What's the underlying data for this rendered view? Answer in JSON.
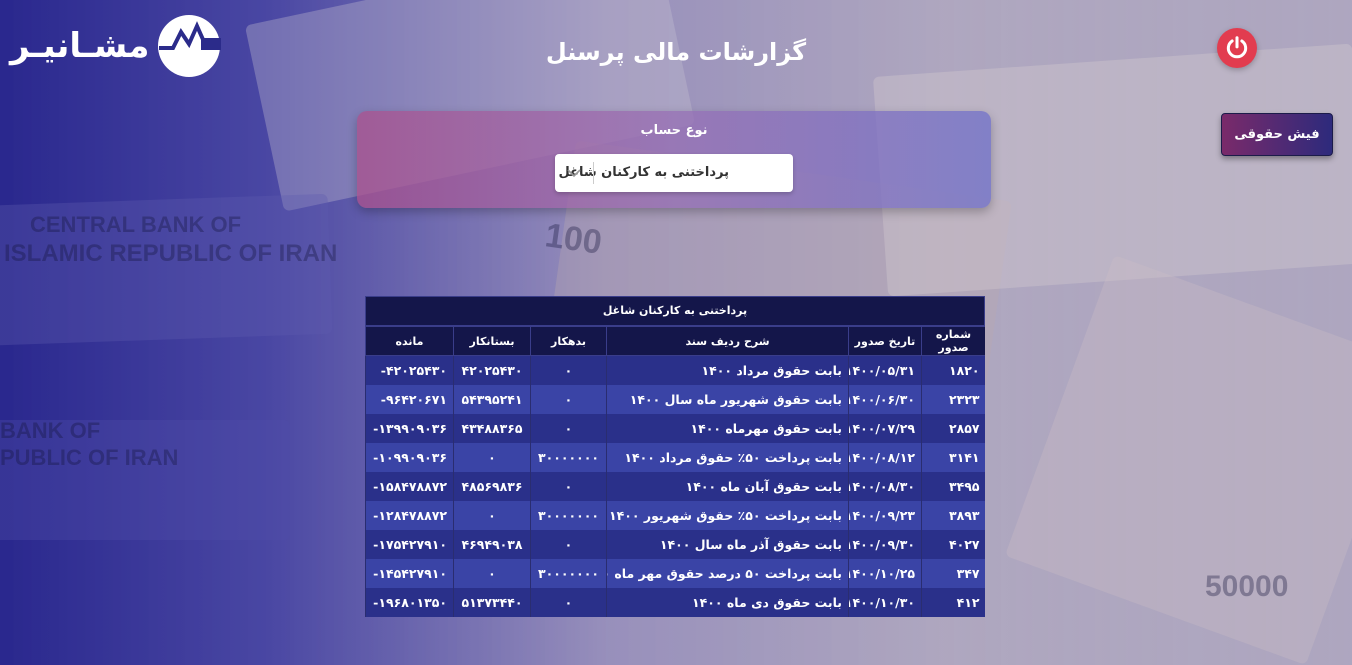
{
  "brand": {
    "name": "مشـانیـر"
  },
  "page": {
    "title": "گزارشات مالی پرسنل"
  },
  "header": {
    "payslip_button": "فیش حقوقی"
  },
  "account": {
    "label": "نوع حساب",
    "selected": "پرداختنی به کارکنان شاغل"
  },
  "table": {
    "caption": "پرداختنی به کارکنان شاغل",
    "columns": [
      "شماره صدور",
      "تاریخ صدور",
      "شرح ردیف سند",
      "بدهکار",
      "بستانکار",
      "مانده"
    ],
    "rows": [
      [
        "۱۸۲۰",
        "۱۴۰۰/۰۵/۳۱",
        "بابت حقوق مرداد ۱۴۰۰",
        "۰",
        "۴۲۰۲۵۴۳۰",
        "-۴۲۰۲۵۴۳۰"
      ],
      [
        "۲۳۲۳",
        "۱۴۰۰/۰۶/۳۰",
        "بابت حقوق شهریور ماه سال ۱۴۰۰",
        "۰",
        "۵۴۳۹۵۲۴۱",
        "-۹۶۴۲۰۶۷۱"
      ],
      [
        "۲۸۵۷",
        "۱۴۰۰/۰۷/۲۹",
        "بابت حقوق مهرماه ۱۴۰۰",
        "۰",
        "۴۳۴۸۸۳۶۵",
        "-۱۳۹۹۰۹۰۳۶"
      ],
      [
        "۳۱۴۱",
        "۱۴۰۰/۰۸/۱۲",
        "بابت پرداخت ۵۰٪ حقوق مرداد ۱۴۰۰",
        "۳۰۰۰۰۰۰۰",
        "۰",
        "-۱۰۹۹۰۹۰۳۶"
      ],
      [
        "۳۴۹۵",
        "۱۴۰۰/۰۸/۳۰",
        "بابت حقوق آبان ماه ۱۴۰۰",
        "۰",
        "۴۸۵۶۹۸۳۶",
        "-۱۵۸۴۷۸۸۷۲"
      ],
      [
        "۳۸۹۳",
        "۱۴۰۰/۰۹/۲۳",
        "بابت پرداخت ۵۰٪ حقوق شهریور ۱۴۰۰",
        "۳۰۰۰۰۰۰۰",
        "۰",
        "-۱۲۸۴۷۸۸۷۲"
      ],
      [
        "۴۰۲۷",
        "۱۴۰۰/۰۹/۳۰",
        "بابت حقوق آذر ماه سال ۱۴۰۰",
        "۰",
        "۴۶۹۴۹۰۳۸",
        "-۱۷۵۴۲۷۹۱۰"
      ],
      [
        "۳۴۷",
        "۱۴۰۰/۱۰/۲۵",
        "بابت پرداخت ۵۰ درصد حقوق مهر ماه ۱۴۰۰",
        "۳۰۰۰۰۰۰۰",
        "۰",
        "-۱۴۵۴۲۷۹۱۰"
      ],
      [
        "۴۱۲",
        "۱۴۰۰/۱۰/۳۰",
        "بابت حقوق دی ماه ۱۴۰۰",
        "۰",
        "۵۱۳۷۳۴۴۰",
        "-۱۹۶۸۰۱۳۵۰"
      ]
    ]
  },
  "background_notes": [
    "CENTRAL BANK OF",
    "ISLAMIC REPUBLIC OF IRAN",
    "BANK OF",
    "PUBLIC OF IRAN",
    "50000",
    "100"
  ],
  "colors": {
    "power": "#e23c4f",
    "table_header": "#14164a",
    "row_odd": "#2a308a",
    "row_even": "#3a44a6"
  },
  "icons": [
    "logo-icon",
    "power-icon",
    "chevron-down-icon"
  ]
}
